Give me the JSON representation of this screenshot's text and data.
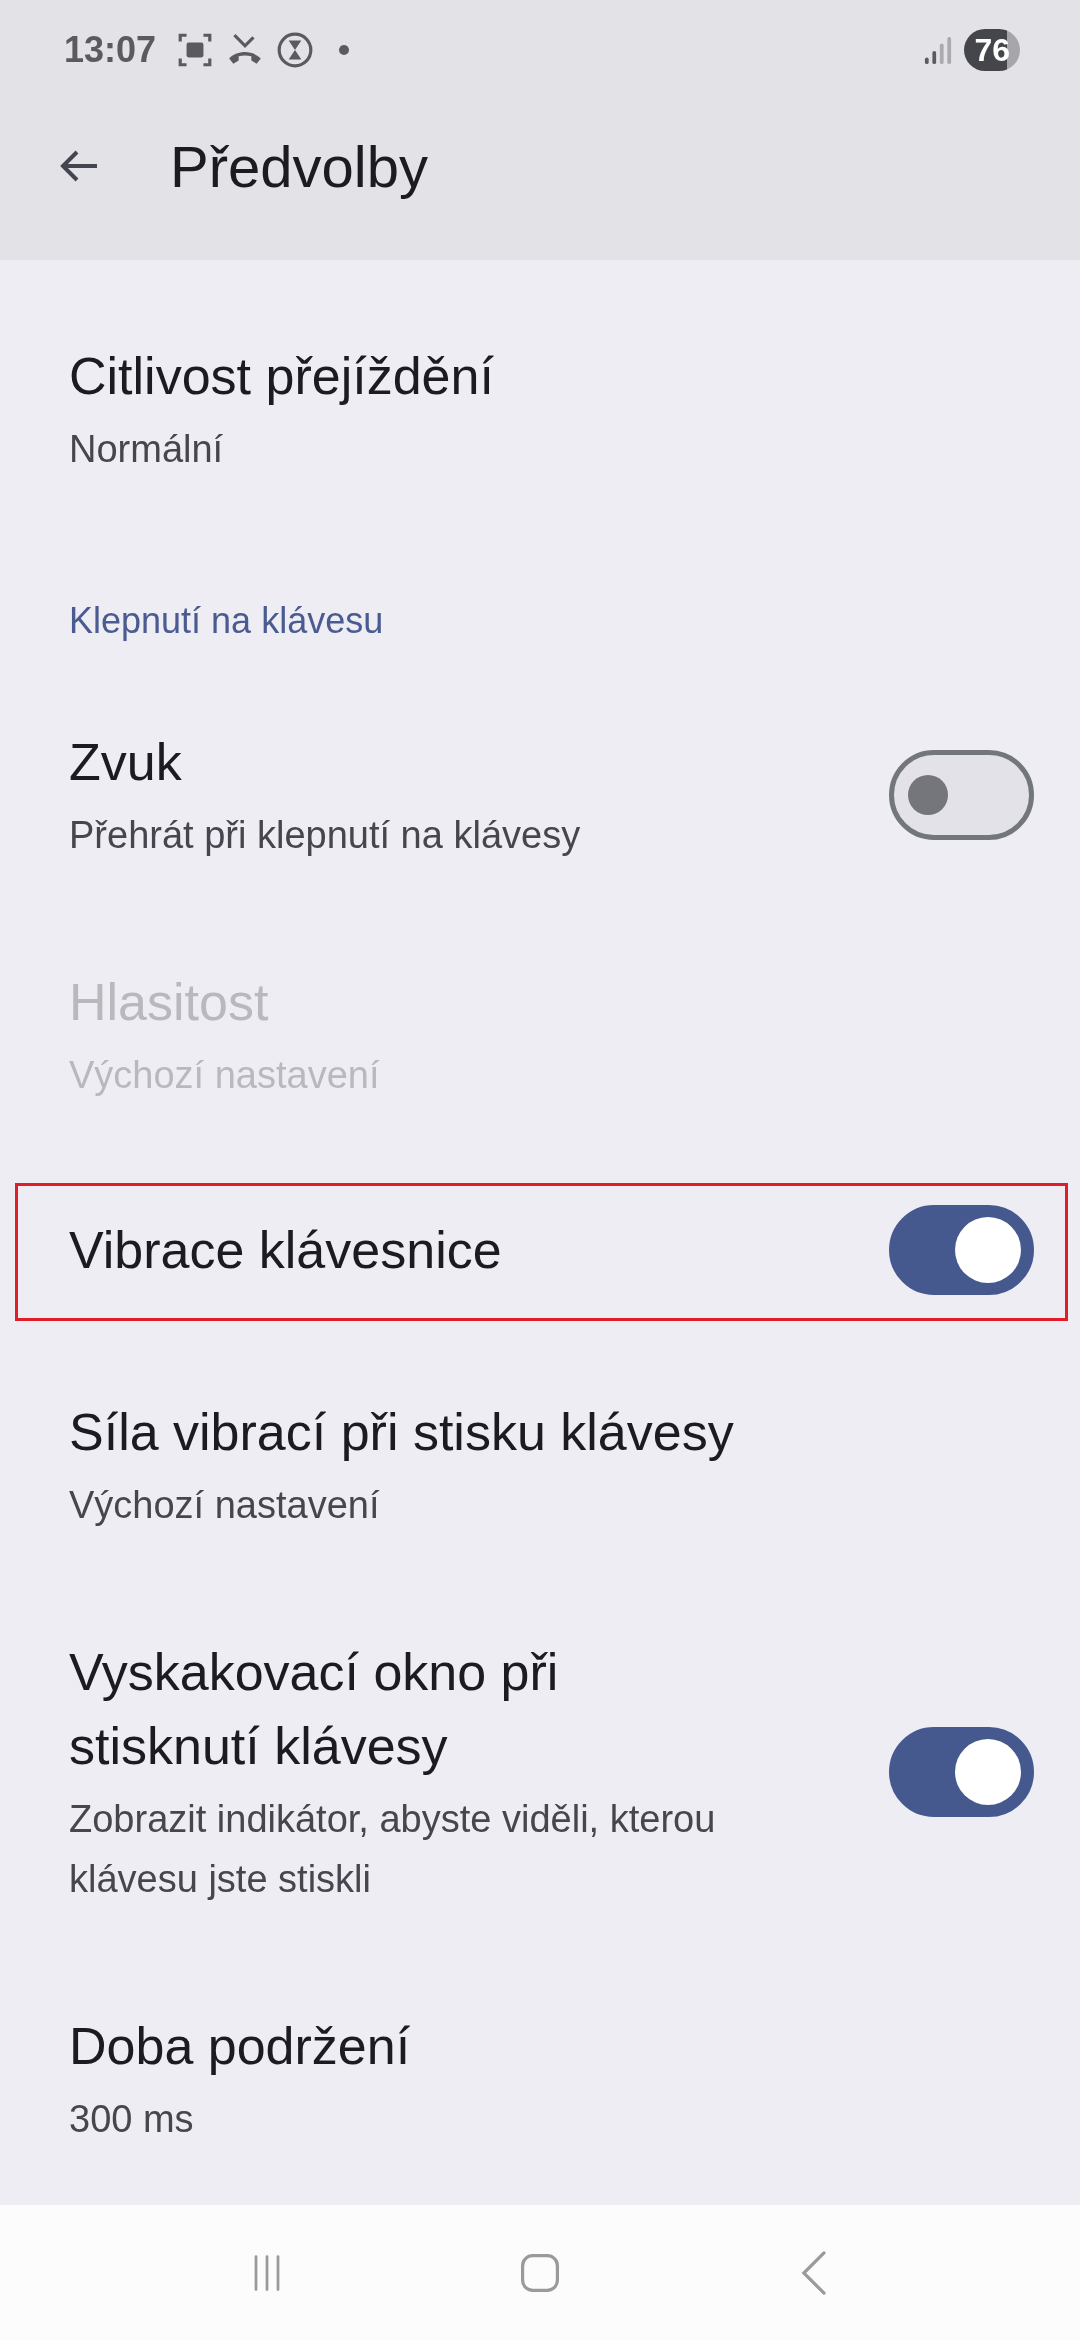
{
  "status_bar": {
    "time": "13:07",
    "battery": "76"
  },
  "app_bar": {
    "title": "Předvolby"
  },
  "items": [
    {
      "kind": "setting",
      "title": "Citlivost přejíždění",
      "summary": "Normální",
      "disabled": false,
      "highlighted": false
    },
    {
      "kind": "header",
      "title": "Klepnutí na klávesu"
    },
    {
      "kind": "switch",
      "title": "Zvuk",
      "summary": "Přehrát při klepnutí na klávesy",
      "on": false,
      "disabled": false,
      "highlighted": false
    },
    {
      "kind": "setting",
      "title": "Hlasitost",
      "summary": "Výchozí nastavení",
      "disabled": true,
      "highlighted": false
    },
    {
      "kind": "switch",
      "title": "Vibrace klávesnice",
      "on": true,
      "disabled": false,
      "highlighted": true
    },
    {
      "kind": "setting",
      "title": "Síla vibrací při stisku klávesy",
      "summary": "Výchozí nastavení",
      "disabled": false,
      "highlighted": false
    },
    {
      "kind": "switch",
      "title": "Vyskakovací okno při stisknutí klávesy",
      "summary": "Zobrazit indikátor, abyste viděli, kterou klávesu jste stiskli",
      "on": true,
      "disabled": false,
      "highlighted": false
    },
    {
      "kind": "setting",
      "title": "Doba podržení",
      "summary": "300 ms",
      "disabled": false,
      "highlighted": false
    }
  ]
}
